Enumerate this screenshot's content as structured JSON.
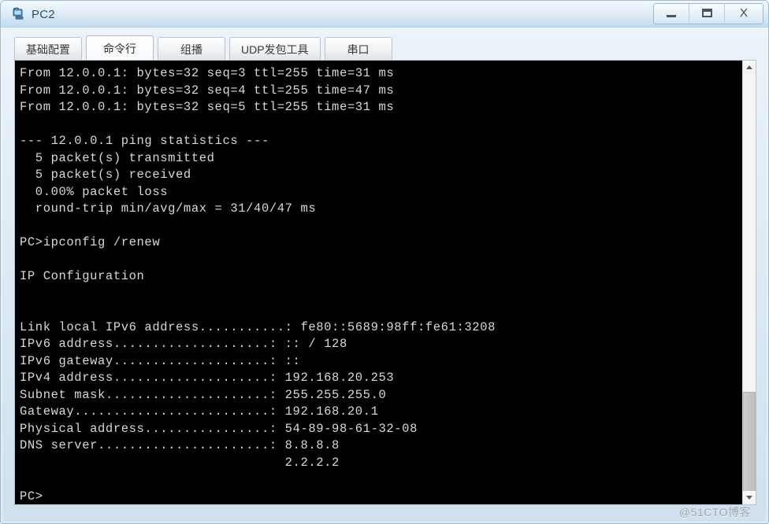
{
  "window": {
    "title": "PC2",
    "icon": "pc-device-icon",
    "buttons": {
      "minimize": "minimize-icon",
      "maximize": "maximize-icon",
      "close": "X"
    }
  },
  "tabs": [
    {
      "label": "基础配置",
      "active": false
    },
    {
      "label": "命令行",
      "active": true
    },
    {
      "label": "组播",
      "active": false
    },
    {
      "label": "UDP发包工具",
      "active": false
    },
    {
      "label": "串口",
      "active": false
    }
  ],
  "console": {
    "lines": [
      "From 12.0.0.1: bytes=32 seq=3 ttl=255 time=31 ms",
      "From 12.0.0.1: bytes=32 seq=4 ttl=255 time=47 ms",
      "From 12.0.0.1: bytes=32 seq=5 ttl=255 time=31 ms",
      "",
      "--- 12.0.0.1 ping statistics ---",
      "  5 packet(s) transmitted",
      "  5 packet(s) received",
      "  0.00% packet loss",
      "  round-trip min/avg/max = 31/40/47 ms",
      "",
      "PC>ipconfig /renew",
      "",
      "IP Configuration",
      "",
      "",
      "Link local IPv6 address...........: fe80::5689:98ff:fe61:3208",
      "IPv6 address....................: :: / 128",
      "IPv6 gateway....................: ::",
      "IPv4 address....................: 192.168.20.253",
      "Subnet mask.....................: 255.255.255.0",
      "Gateway.........................: 192.168.20.1",
      "Physical address................: 54-89-98-61-32-08",
      "DNS server......................: 8.8.8.8",
      "                                  2.2.2.2",
      "",
      "PC>"
    ]
  },
  "scrollbar": {
    "up_arrow": "chevron-up-icon",
    "down_arrow": "chevron-down-icon"
  },
  "watermark": {
    "text": "@51CTO博客"
  },
  "colors": {
    "console_bg": "#000000",
    "console_text": "#d8d8d8",
    "title_accent": "#2a4d6e",
    "frame": "#9fbcd4"
  }
}
